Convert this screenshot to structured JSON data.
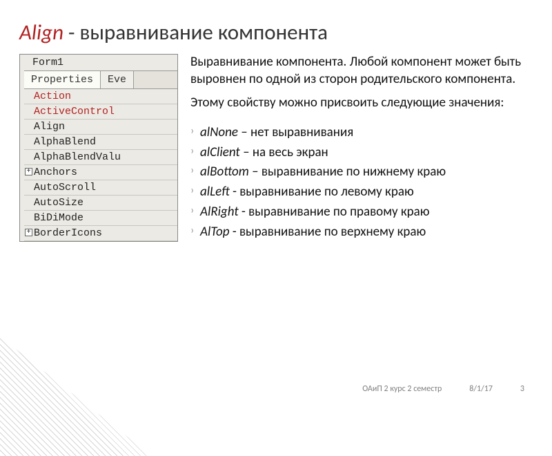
{
  "title": {
    "em": "Align",
    "rest": " - выравнивание компонента"
  },
  "panel": {
    "top": "Form1",
    "tabs": {
      "active": "Properties",
      "other": "Eve"
    },
    "rows": [
      {
        "label": "Action",
        "red": true,
        "expand": false
      },
      {
        "label": "ActiveControl",
        "red": true,
        "expand": false
      },
      {
        "label": "Align",
        "red": false,
        "expand": false
      },
      {
        "label": "AlphaBlend",
        "red": false,
        "expand": false
      },
      {
        "label": "AlphaBlendValu",
        "red": false,
        "expand": false
      },
      {
        "label": "Anchors",
        "red": false,
        "expand": true
      },
      {
        "label": "AutoScroll",
        "red": false,
        "expand": false
      },
      {
        "label": "AutoSize",
        "red": false,
        "expand": false
      },
      {
        "label": "BiDiMode",
        "red": false,
        "expand": false
      },
      {
        "label": "BorderIcons",
        "red": false,
        "expand": true
      }
    ]
  },
  "description": {
    "p1": "Выравнивание компонента. Любой компонент может быть выровнен по одной из сторон родительского компонента.",
    "p2": "Этому свойству можно присвоить следующие значения:"
  },
  "bullets": [
    {
      "term": "alNone",
      "desc": " – нет выравнивания"
    },
    {
      "term": "alClient",
      "desc": " – на весь экран"
    },
    {
      "term": "alBottom",
      "desc": " – выравнивание по нижнему краю"
    },
    {
      "term": "alLeft",
      "desc": " - выравнивание по левому краю"
    },
    {
      "term": "AlRight",
      "desc": " - выравнивание по правому краю"
    },
    {
      "term": "AlTop",
      "desc": " - выравнивание по верхнему краю"
    }
  ],
  "footer": {
    "course": "ОАиП 2 курс 2 семестр",
    "date": "8/1/17",
    "page": "3"
  }
}
